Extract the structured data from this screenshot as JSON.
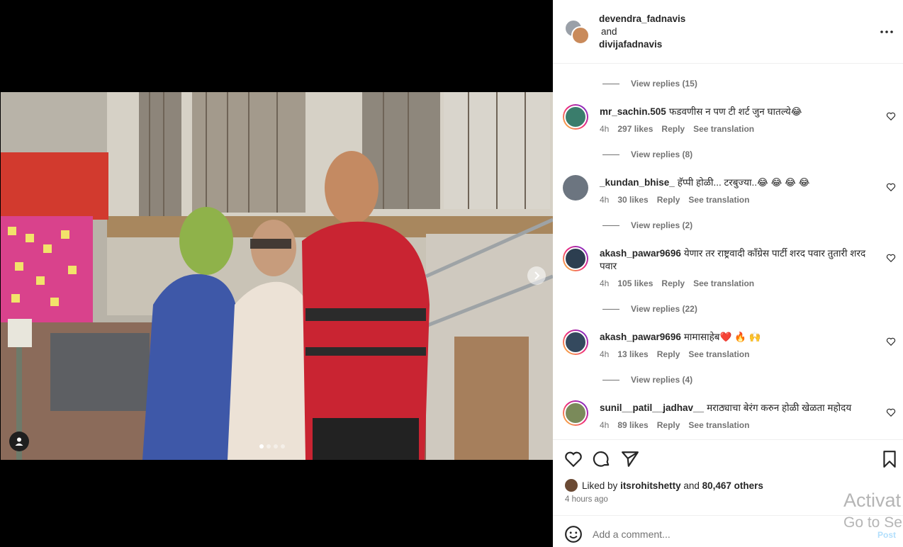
{
  "post": {
    "authors": [
      "devendra_fadnavis",
      "divijafadnavis"
    ],
    "and_label": "and"
  },
  "carousel": {
    "slides": 4,
    "active": 1
  },
  "comments": {
    "view_replies_top": "View replies (15)",
    "items": [
      {
        "user": "mr_sachin.505",
        "text": "फडवणीस न पण टी शर्ट जुन घातल्ये😂",
        "time": "4h",
        "likes": "297 likes",
        "reply": "Reply",
        "see_translation": "See translation",
        "view_replies": "View replies (8)",
        "ring": true,
        "avatar_color": "#3a7d6c"
      },
      {
        "user": "_kundan_bhise_",
        "text": "हॅप्पी होळी... टरबुज्या..😂 😂 😂 😂",
        "time": "4h",
        "likes": "30 likes",
        "reply": "Reply",
        "see_translation": "See translation",
        "view_replies": "View replies (2)",
        "ring": false,
        "avatar_color": "#6c7580"
      },
      {
        "user": "akash_pawar9696",
        "text": "येणार तर राष्ट्रवादी काँग्रेस पार्टी शरद पवार तुतारी शरद पवार",
        "time": "4h",
        "likes": "105 likes",
        "reply": "Reply",
        "see_translation": "See translation",
        "view_replies": "View replies (22)",
        "ring": true,
        "avatar_color": "#2c3e50"
      },
      {
        "user": "akash_pawar9696",
        "text": "मामासाहेब❤️ 🔥 🙌",
        "time": "4h",
        "likes": "13 likes",
        "reply": "Reply",
        "see_translation": "See translation",
        "view_replies": "View replies (4)",
        "ring": true,
        "avatar_color": "#34495e"
      },
      {
        "user": "sunil__patil__jadhav__",
        "text": "मराठ्याचा बेरंग करुन होळी खेळता महोदय",
        "time": "4h",
        "likes": "89 likes",
        "reply": "Reply",
        "see_translation": "See translation",
        "view_replies": "",
        "ring": true,
        "avatar_color": "#7a8a5a"
      }
    ]
  },
  "likes": {
    "prefix": "Liked by",
    "user": "itsrohitshetty",
    "middle": "and",
    "others": "80,467 others"
  },
  "timestamp": "4 hours ago",
  "add_comment": {
    "placeholder": "Add a comment...",
    "post_label": "Post"
  },
  "watermark": {
    "line1": "Activat",
    "line2": "Go to Se"
  },
  "colors": {
    "accent": "#0095f6",
    "muted": "#737373",
    "text": "#262626"
  }
}
